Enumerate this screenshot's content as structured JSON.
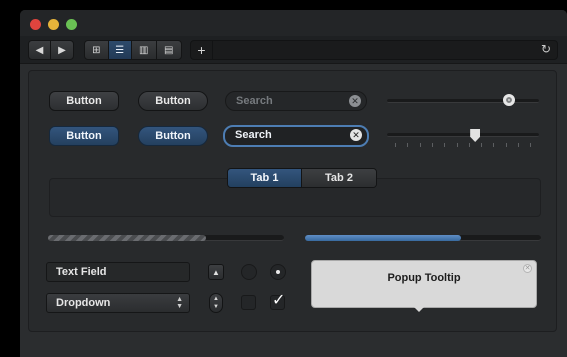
{
  "colors": {
    "window_bg": "#2b2d2f",
    "accent_blue": "#33557d",
    "focus_ring": "#4d7db3",
    "progress_blue": "#4a7db6",
    "tooltip_bg": "#d9d9d9",
    "close": "#e0443e",
    "minimize": "#e5b33a",
    "maximize": "#6ac154"
  },
  "toolbar": {
    "back_icon": "◀",
    "forward_icon": "▶",
    "view_icons": [
      "⊞",
      "☰",
      "▥",
      "▤"
    ],
    "active_view": 1,
    "add_icon": "+",
    "reload_icon": "↻"
  },
  "buttons": {
    "regular": "Button",
    "round": "Button",
    "blue_regular": "Button",
    "blue_round": "Button"
  },
  "search": {
    "placeholder": "Search",
    "focused_value": "Search",
    "clear_icon": "✕"
  },
  "sliders": {
    "round_knob_value": 0.8,
    "ticked_value": 0.58
  },
  "tabs": {
    "items": [
      "Tab 1",
      "Tab 2"
    ],
    "active": 0
  },
  "progress": {
    "indeterminate_fill": 0.67,
    "determinate_fill": 0.66
  },
  "controls": {
    "text_field": "Text Field",
    "dropdown": "Dropdown",
    "dropdown_arrows": "▲▼",
    "disclosure_icon": "▲",
    "stepper_icon": "▲▼",
    "radio_on": true,
    "checkbox_checked": true,
    "checkmark": "✓"
  },
  "tooltip": {
    "title": "Popup Tooltip",
    "close_icon": "✕"
  }
}
